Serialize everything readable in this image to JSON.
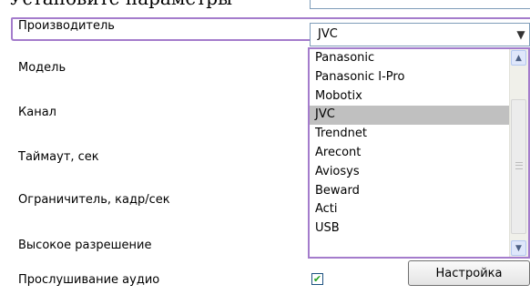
{
  "header": {
    "partial_text": "Установите параметры",
    "partial_value": ""
  },
  "form": {
    "manufacturer_label": "Производитель",
    "manufacturer_value": "JVC",
    "model_label": "Модель",
    "channel_label": "Канал",
    "timeout_label": "Таймаут, сек",
    "fps_limit_label": "Ограничитель, кадр/сек",
    "high_res_label": "Высокое разрешение",
    "audio_label": "Прослушивание аудио",
    "audio_checked": true,
    "check_glyph": "✔",
    "setup_button": "Настройка"
  },
  "dropdown": {
    "options": [
      "Panasonic",
      "Panasonic I-Pro",
      "Mobotix",
      "JVC",
      "Trendnet",
      "Arecont",
      "Aviosys",
      "Beward",
      "Acti",
      "USB"
    ],
    "selected_index": 3
  },
  "icons": {
    "select_arrow": "chevron-down-icon",
    "scroll_up": "scroll-up-arrow-icon",
    "scroll_down": "scroll-down-arrow-icon",
    "check": "checkmark-icon"
  },
  "colors": {
    "highlight": "#a47ccc",
    "selection": "#c0c0c0",
    "check": "#21a121"
  }
}
